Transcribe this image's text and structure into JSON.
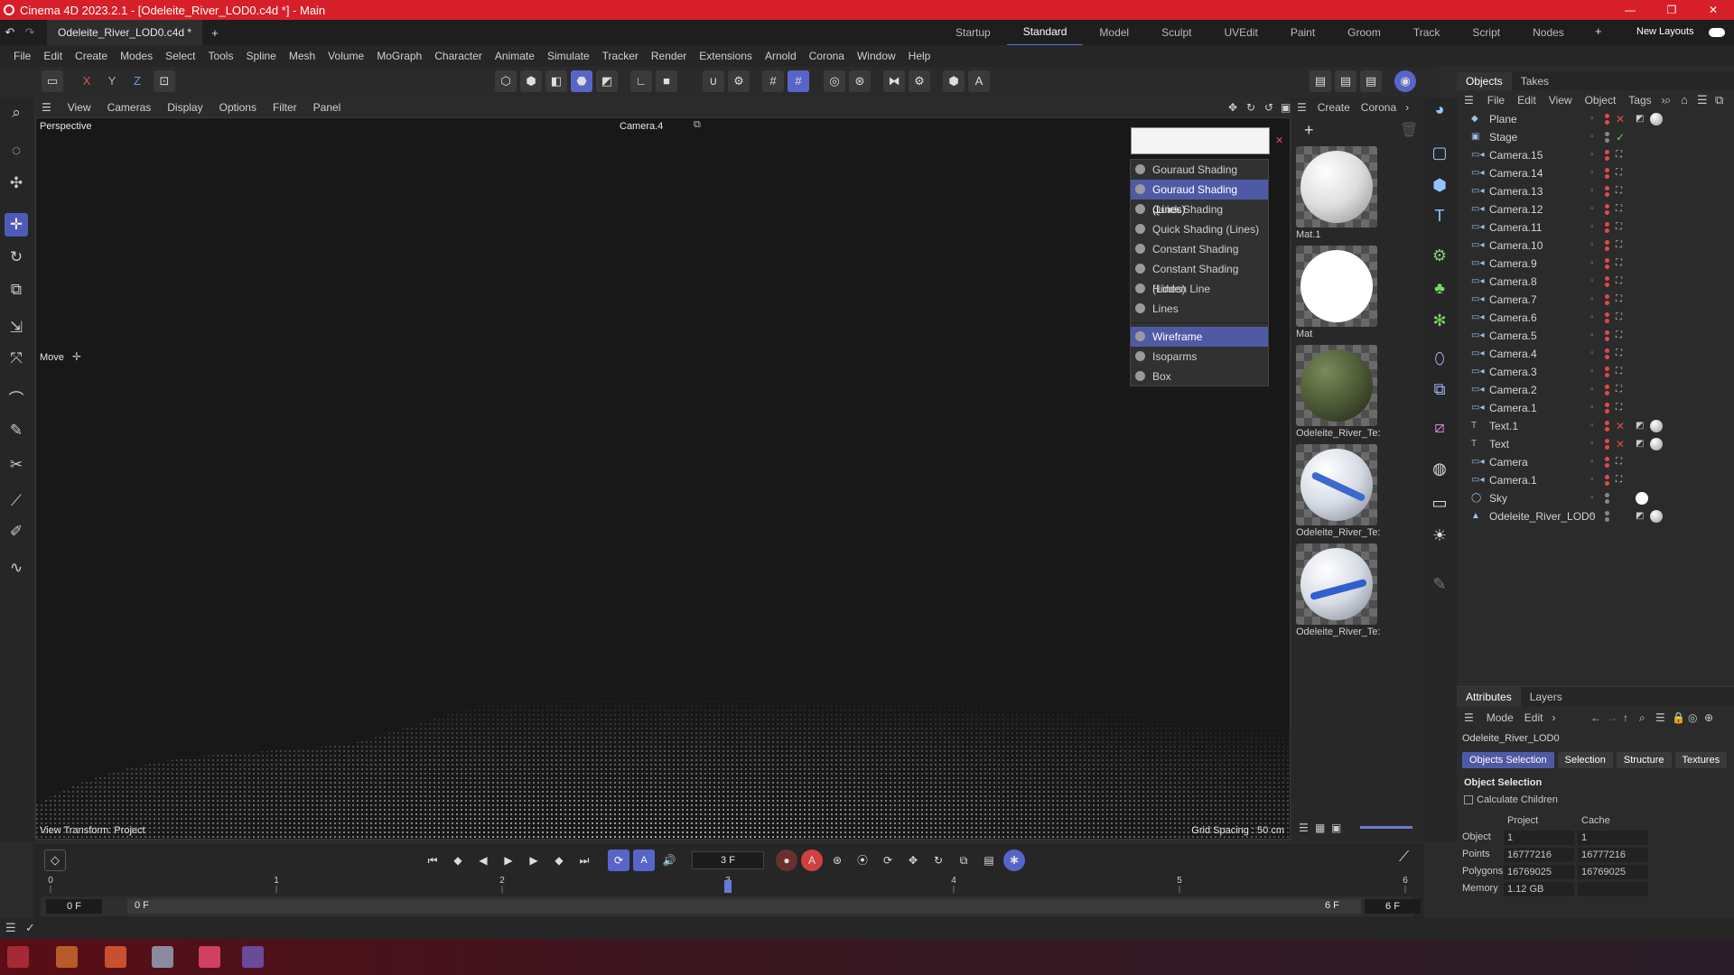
{
  "window": {
    "title": "Cinema 4D 2023.2.1 - [Odeleite_River_LOD0.c4d *] - Main",
    "min": "—",
    "max": "❐",
    "close": "✕"
  },
  "tabs": {
    "doc": "Odeleite_River_LOD0.c4d *",
    "add": "+"
  },
  "layouts": [
    "Startup",
    "Standard",
    "Model",
    "Sculpt",
    "UVEdit",
    "Paint",
    "Groom",
    "Track",
    "Script",
    "Nodes"
  ],
  "layouts_extra": {
    "plus": "+",
    "new_layouts": "New Layouts"
  },
  "menu": [
    "File",
    "Edit",
    "Create",
    "Modes",
    "Select",
    "Tools",
    "Spline",
    "Mesh",
    "Volume",
    "MoGraph",
    "Character",
    "Animate",
    "Simulate",
    "Tracker",
    "Render",
    "Extensions",
    "Arnold",
    "Corona",
    "Window",
    "Help"
  ],
  "axis": {
    "x": "X",
    "y": "Y",
    "z": "Z"
  },
  "viewport_menu": [
    "View",
    "Cameras",
    "Display",
    "Options",
    "Filter",
    "Panel"
  ],
  "viewport": {
    "name": "Perspective",
    "camera": "Camera.4",
    "tool": "Move",
    "transform": "View Transform: Project",
    "grid": "Grid Spacing : 50 cm"
  },
  "shading_menu": [
    {
      "label": "Gouraud Shading",
      "selected": false
    },
    {
      "label": "Gouraud Shading (Lines)",
      "selected": true
    },
    {
      "label": "Quick Shading",
      "selected": false
    },
    {
      "label": "Quick Shading (Lines)",
      "selected": false
    },
    {
      "label": "Constant Shading",
      "selected": false
    },
    {
      "label": "Constant Shading (Lines)",
      "selected": false
    },
    {
      "label": "Hidden Line",
      "selected": false
    },
    {
      "label": "Lines",
      "selected": false
    },
    {
      "label": "Wireframe",
      "selected": true
    },
    {
      "label": "Isoparms",
      "selected": false
    },
    {
      "label": "Box",
      "selected": false
    }
  ],
  "materials_menu": {
    "create": "Create",
    "corona": "Corona"
  },
  "materials": [
    "Mat.1",
    "Mat",
    "Odeleite_River_Te:",
    "Odeleite_River_Te:",
    "Odeleite_River_Te:"
  ],
  "objects_tabs": {
    "objects": "Objects",
    "takes": "Takes"
  },
  "objects_menu": [
    "File",
    "Edit",
    "View",
    "Object",
    "Tags"
  ],
  "objects": [
    "Plane",
    "Stage",
    "Camera.15",
    "Camera.14",
    "Camera.13",
    "Camera.12",
    "Camera.11",
    "Camera.10",
    "Camera.9",
    "Camera.8",
    "Camera.7",
    "Camera.6",
    "Camera.5",
    "Camera.4",
    "Camera.3",
    "Camera.2",
    "Camera.1",
    "Text.1",
    "Text",
    "Camera",
    "Camera.1",
    "Sky",
    "Odeleite_River_LOD0"
  ],
  "attributes": {
    "tabs": {
      "attributes": "Attributes",
      "layers": "Layers"
    },
    "menu": {
      "mode": "Mode",
      "edit": "Edit"
    },
    "object_name": "Odeleite_River_LOD0",
    "subtabs": [
      "Objects Selection",
      "Selection",
      "Structure",
      "Textures"
    ],
    "section": "Object Selection",
    "checkbox": "Calculate Children",
    "headers": {
      "project": "Project",
      "cache": "Cache"
    },
    "rows": [
      {
        "label": "Object",
        "project": "1",
        "cache": "1"
      },
      {
        "label": "Points",
        "project": "16777216",
        "cache": "16777216"
      },
      {
        "label": "Polygons",
        "project": "16769025",
        "cache": "16769025"
      },
      {
        "label": "Memory",
        "project": "1.12 GB",
        "cache": ""
      }
    ]
  },
  "timeline": {
    "ticks": [
      "0",
      "1",
      "2",
      "3",
      "4",
      "5",
      "6"
    ],
    "current": "3 F",
    "start": "0 F",
    "start2": "0 F",
    "end": "6 F",
    "end2": "6 F",
    "current_frame": 3,
    "max_frame": 6
  }
}
